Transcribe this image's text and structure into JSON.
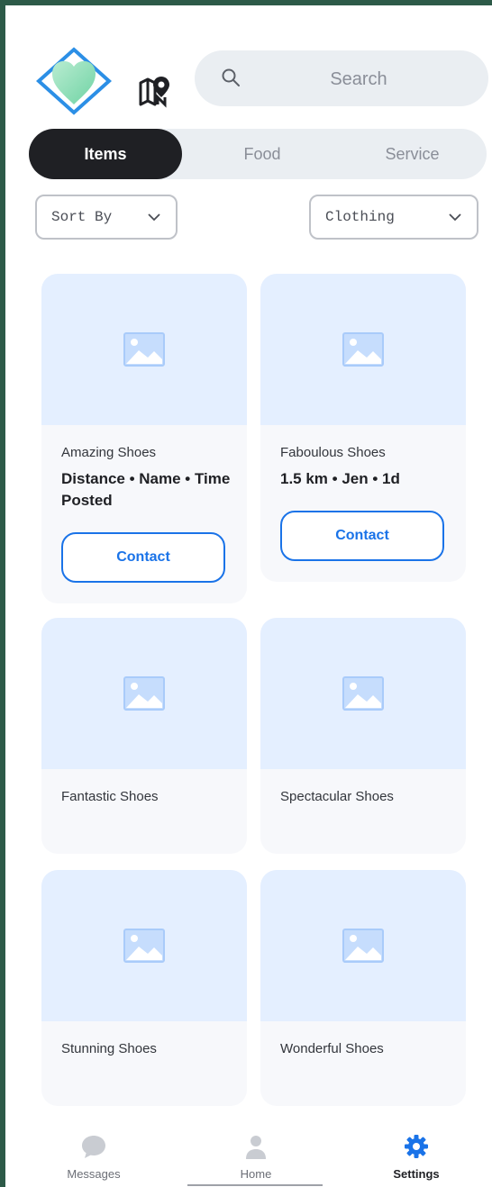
{
  "search": {
    "placeholder": "Search"
  },
  "tabs": [
    {
      "label": "Items",
      "active": true
    },
    {
      "label": "Food",
      "active": false
    },
    {
      "label": "Service",
      "active": false
    }
  ],
  "filters": {
    "sort_label": "Sort By",
    "category_label": "Clothing"
  },
  "cards": [
    {
      "title": "Amazing Shoes",
      "meta": "Distance • Name • Time Posted",
      "button": "Contact"
    },
    {
      "title": "Faboulous Shoes",
      "meta": "1.5 km • Jen • 1d",
      "button": "Contact"
    },
    {
      "title": "Fantastic Shoes"
    },
    {
      "title": "Spectacular Shoes"
    },
    {
      "title": "Stunning Shoes"
    },
    {
      "title": "Wonderful Shoes"
    }
  ],
  "nav": [
    {
      "label": "Messages",
      "icon": "chat-bubble-icon",
      "active": false
    },
    {
      "label": "Home",
      "icon": "person-icon",
      "active": false
    },
    {
      "label": "Settings",
      "icon": "gear-icon",
      "active": true
    }
  ],
  "colors": {
    "accent": "#1a73e8",
    "tab_active": "#1f2024",
    "thumb_bg": "#e4efff",
    "card_bg": "#f7f8fb"
  }
}
